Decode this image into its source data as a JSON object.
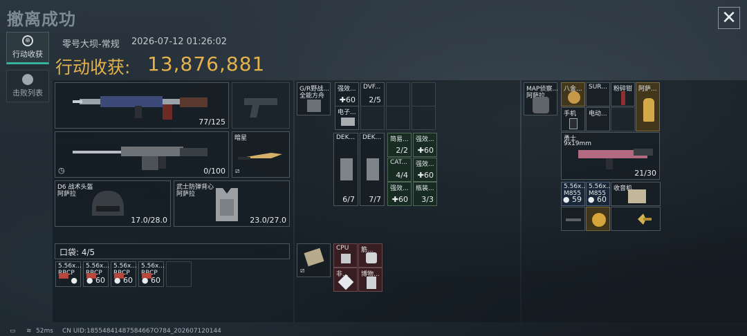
{
  "header": {
    "title": "撤离成功",
    "close": "✕"
  },
  "sidebar": {
    "items": [
      {
        "label": "行动收获",
        "icon": "⊕"
      },
      {
        "label": "击败列表",
        "icon": "☠"
      }
    ]
  },
  "meta": {
    "map": "零号大坝-常规",
    "datetime": "2026-07-12 01:26:02"
  },
  "summary": {
    "label": "行动收获:",
    "value": "13,876,881"
  },
  "equipment": {
    "primary": {
      "count": "77/125"
    },
    "secondary": {
      "count": "0/100"
    },
    "knife": {
      "name": "暗星"
    },
    "helmet": {
      "name": "D6 战术头盔",
      "sub": "阿萨拉",
      "durability": "17.0/28.0"
    },
    "armor": {
      "name": "武士防弹背心",
      "sub": "阿萨拉",
      "durability": "23.0/27.0"
    }
  },
  "pouch": {
    "label": "口袋: 4/5",
    "items": [
      {
        "name": "5.56x...",
        "sub": "RRCP",
        "count": "●"
      },
      {
        "name": "5.56x...",
        "sub": "RRCP",
        "count": "● 60"
      },
      {
        "name": "5.56x...",
        "sub": "RRCP",
        "count": "● 60"
      },
      {
        "name": "5.56x...",
        "sub": "RRCP",
        "count": "● 60"
      }
    ]
  },
  "chest": {
    "rig": {
      "name": "G/R野战...",
      "sub": "全能方舟"
    },
    "a1": {
      "name": "强效...",
      "count": "✚60"
    },
    "a2": {
      "name": "DVF...",
      "count": "2/5"
    },
    "a3": {
      "name": "电子..."
    },
    "dek1": {
      "name": "DEK...",
      "count": "6/7"
    },
    "dek2": {
      "name": "DEK...",
      "count": "7/7"
    },
    "c1": {
      "name": "简易...",
      "count": "2/2"
    },
    "c2": {
      "name": "强效...",
      "count": "✚60"
    },
    "c3": {
      "name": "CAT...",
      "count": "4/4"
    },
    "c4": {
      "name": "强效...",
      "count": "✚60"
    },
    "c5": {
      "name": "强效...",
      "count": "✚60"
    },
    "c6": {
      "name": "瓶装...",
      "count": "3/3"
    },
    "case": {
      "name": ""
    },
    "cpu": {
      "name": "CPU"
    },
    "p2": {
      "name": "筋..."
    },
    "p3": {
      "name": "非..."
    },
    "p4": {
      "name": "博物..."
    }
  },
  "backpack": {
    "bag": {
      "name": "MAP侦察...",
      "sub": "阿萨拉"
    },
    "b1": {
      "name": "八金..."
    },
    "b2": {
      "name": "SUR..."
    },
    "b3": {
      "name": "粉碎钳"
    },
    "b4": {
      "name": "阿萨..."
    },
    "b5": {
      "name": "手机"
    },
    "b6": {
      "name": "电动..."
    },
    "gun": {
      "name": "勇士",
      "sub": "9x19mm",
      "count": "21/30"
    },
    "m1": {
      "name": "5.56x...",
      "sub": "M855",
      "count": "● 59"
    },
    "m2": {
      "name": "5.56x...",
      "sub": "M855",
      "count": "● 60"
    },
    "rec": {
      "name": "收音机"
    }
  },
  "status": {
    "ping": "52ms",
    "uid": "CN UID:18554841487584667O784_202607120144"
  },
  "colors": {
    "accent": "#e4b24c",
    "active_tab": "#36b39a"
  }
}
